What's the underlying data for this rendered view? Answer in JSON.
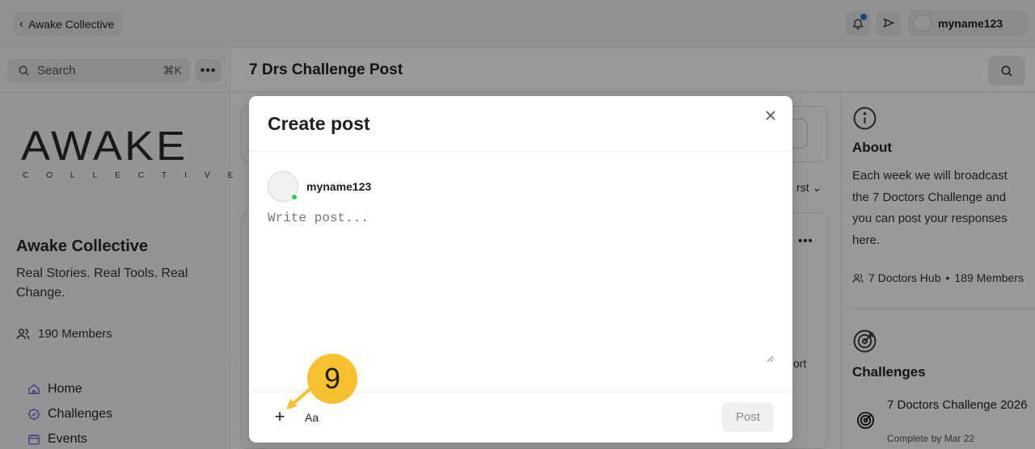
{
  "topbar": {
    "back_label": "Awake Collective",
    "user_name": "myname123"
  },
  "sidebar": {
    "search_placeholder": "Search",
    "search_shortcut": "⌘K",
    "logo_word": "AWAKE",
    "logo_sub": "COLLECTIVE",
    "community_name": "Awake Collective",
    "tagline": "Real Stories. Real Tools. Real Change.",
    "members": "190 Members",
    "nav": [
      {
        "label": "Home",
        "icon": "home-icon"
      },
      {
        "label": "Challenges",
        "icon": "badge-check-icon"
      },
      {
        "label": "Events",
        "icon": "calendar-icon"
      }
    ]
  },
  "main": {
    "title": "7 Drs Challenge Post",
    "sort_partial": "rst",
    "post_partial": "ort"
  },
  "right": {
    "about_title": "About",
    "about_text": "Each week we will broadcast the 7 Doctors Challenge and you can post your responses here.",
    "hub_name": "7 Doctors Hub",
    "hub_separator": "•",
    "hub_members": "189 Members",
    "challenges_title": "Challenges",
    "challenge_name": "7 Doctors Challenge 2026",
    "challenge_sub": "Complete by Mar 22"
  },
  "modal": {
    "title": "Create post",
    "author": "myname123",
    "placeholder": "Write post...",
    "text_format_label": "Aa",
    "post_label": "Post"
  },
  "step_marker": {
    "number": "9",
    "color": "#f7c02e"
  },
  "colors": {
    "accent_purple": "#7a56d6",
    "notification_blue": "#2d6fd6",
    "online_green": "#2ecc5a"
  }
}
